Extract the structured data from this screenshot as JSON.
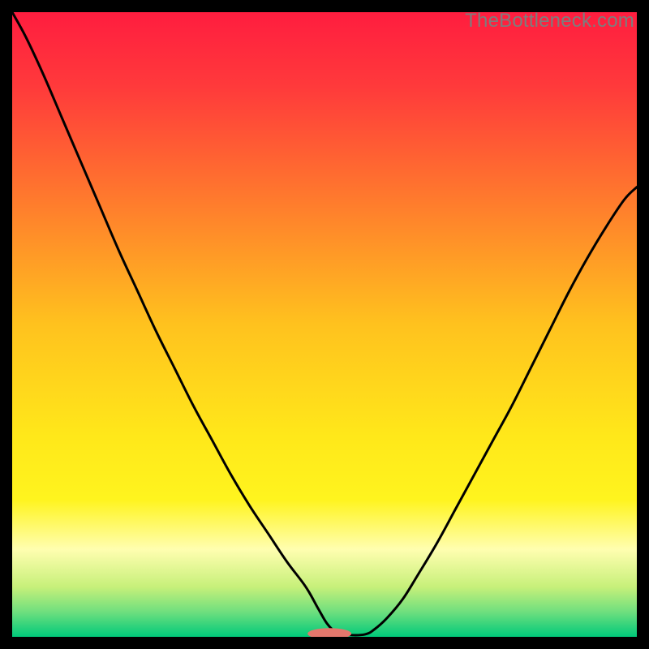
{
  "watermark": "TheBottleneck.com",
  "chart_data": {
    "type": "line",
    "title": "",
    "xlabel": "",
    "ylabel": "",
    "xlim": [
      0,
      100
    ],
    "ylim": [
      0,
      100
    ],
    "background_gradient_stops": [
      {
        "offset": 0.0,
        "color": "#ff1d3f"
      },
      {
        "offset": 0.12,
        "color": "#ff3a3b"
      },
      {
        "offset": 0.3,
        "color": "#ff7a2d"
      },
      {
        "offset": 0.5,
        "color": "#ffc21e"
      },
      {
        "offset": 0.68,
        "color": "#ffe81a"
      },
      {
        "offset": 0.78,
        "color": "#fff41e"
      },
      {
        "offset": 0.86,
        "color": "#fffeb0"
      },
      {
        "offset": 0.92,
        "color": "#c7f07a"
      },
      {
        "offset": 0.96,
        "color": "#6fdf7e"
      },
      {
        "offset": 1.0,
        "color": "#00c97a"
      }
    ],
    "series": [
      {
        "name": "bottleneck-curve",
        "color": "#000000",
        "x": [
          0.0,
          2.2,
          5.0,
          8.0,
          11.0,
          14.0,
          17.0,
          20.0,
          23.0,
          26.0,
          29.0,
          32.0,
          35.0,
          38.0,
          41.0,
          44.0,
          47.0,
          49.0,
          50.5,
          52.0,
          54.0,
          56.5,
          58.0,
          60.0,
          62.5,
          65.0,
          68.0,
          71.0,
          74.0,
          77.0,
          80.0,
          83.0,
          86.0,
          89.0,
          92.0,
          95.0,
          98.0,
          100.0
        ],
        "y": [
          100.0,
          96.0,
          90.0,
          83.0,
          76.0,
          69.0,
          62.0,
          55.5,
          49.0,
          43.0,
          37.0,
          31.5,
          26.0,
          21.0,
          16.5,
          12.0,
          8.0,
          4.5,
          2.0,
          0.7,
          0.3,
          0.4,
          1.2,
          3.0,
          6.0,
          10.0,
          15.0,
          20.5,
          26.0,
          31.5,
          37.0,
          43.0,
          49.0,
          55.0,
          60.5,
          65.5,
          70.0,
          72.0
        ]
      }
    ],
    "marker": {
      "name": "optimal-zone-marker",
      "color": "#e3776c",
      "cx": 50.8,
      "cy": 0.5,
      "rx": 3.5,
      "ry": 0.9
    }
  }
}
